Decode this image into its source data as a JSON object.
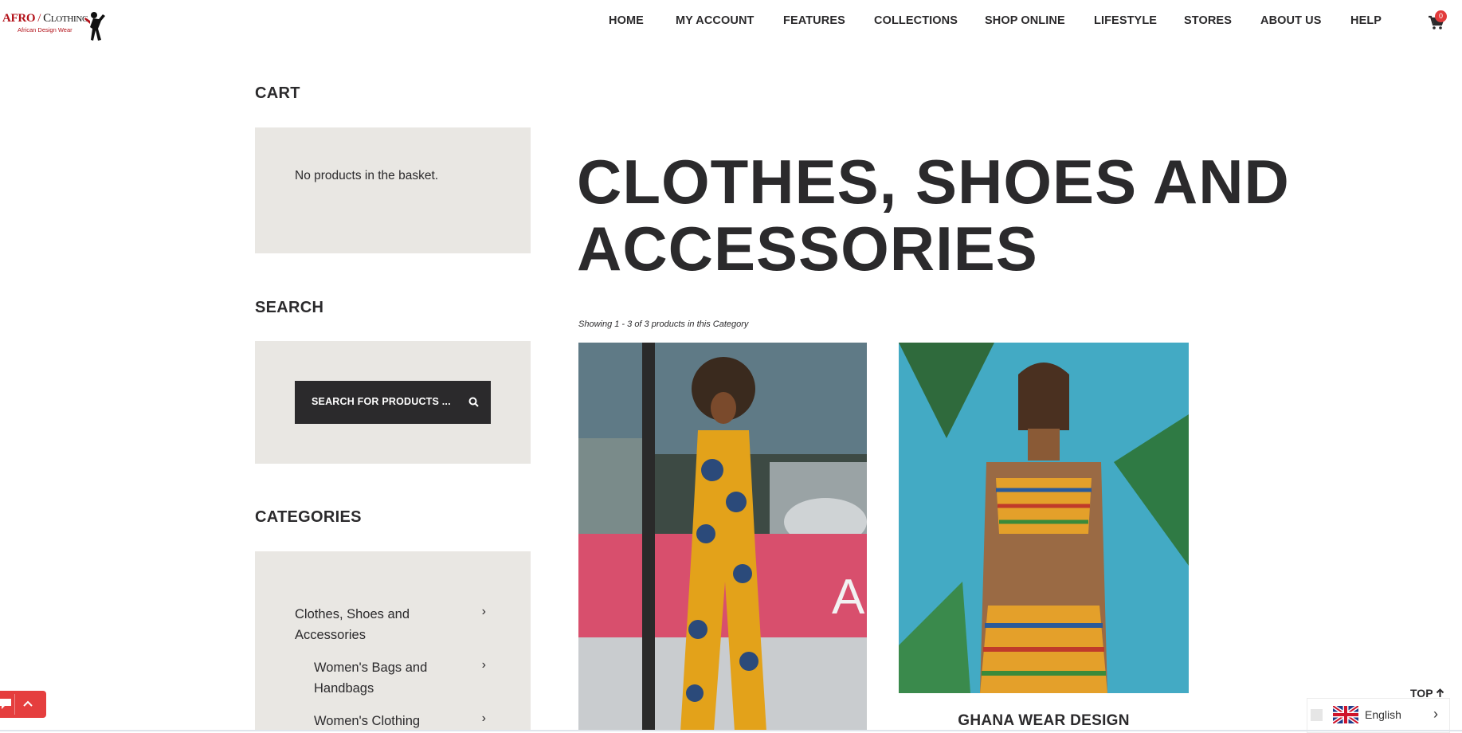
{
  "logo": {
    "primary": "AFRO",
    "separator": "/",
    "secondary": "Clothing",
    "tagline": "African Design Wear"
  },
  "nav": {
    "items": [
      "HOME",
      "MY ACCOUNT",
      "FEATURES",
      "COLLECTIONS",
      "SHOP ONLINE",
      "LIFESTYLE",
      "STORES",
      "ABOUT US",
      "HELP"
    ],
    "cart_count": "0",
    "cart_icon": "cart-icon"
  },
  "sidebar": {
    "cart": {
      "heading": "CART",
      "empty_text": "No products in the basket."
    },
    "search": {
      "heading": "SEARCH",
      "placeholder": "SEARCH FOR PRODUCTS ..."
    },
    "categories": {
      "heading": "CATEGORIES",
      "items": [
        {
          "label": "Clothes, Shoes and Accessories"
        },
        {
          "label": "Women's Bags and Handbags"
        },
        {
          "label": "Women's Clothing"
        }
      ]
    }
  },
  "main": {
    "title": "CLOTHES, SHOES AND ACCESSORIES",
    "count_text": "Showing 1 - 3 of 3 products in this Category",
    "products": [
      {
        "title": ""
      },
      {
        "title": "GHANA WEAR DESIGN"
      }
    ]
  },
  "widgets": {
    "top_label": "TOP",
    "language": "English"
  },
  "colors": {
    "accent": "#e53e3e",
    "text": "#2b2a2c",
    "panel": "#e9e7e3",
    "brand_red": "#b3121a"
  }
}
